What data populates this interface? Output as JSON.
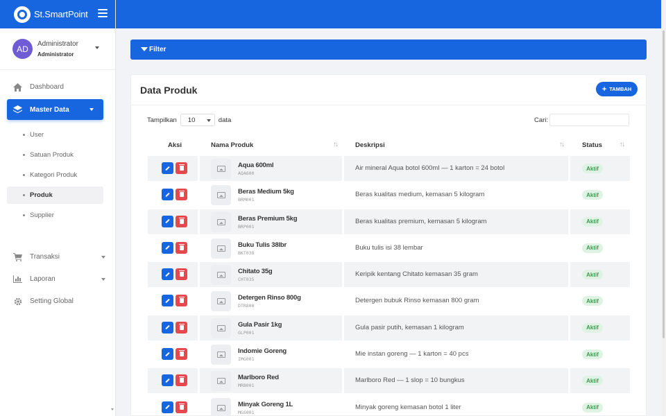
{
  "brand": {
    "name": "St.SmartPoint"
  },
  "user": {
    "initials": "AD",
    "name": "Administrator",
    "role": "Administrator"
  },
  "nav": {
    "dashboard": "Dashboard",
    "master_data": "Master Data",
    "sub": [
      "User",
      "Satuan Produk",
      "Kategori Produk",
      "Produk",
      "Supplier"
    ],
    "transaksi": "Transaksi",
    "laporan": "Laporan",
    "setting": "Setting Global"
  },
  "filter": {
    "label": "Filter"
  },
  "card": {
    "title": "Data Produk",
    "add_label": "TAMBAH"
  },
  "controls": {
    "show_label": "Tampilkan",
    "page_size": "10",
    "data_label": "data",
    "search_label": "Cari:"
  },
  "table": {
    "headers": {
      "aksi": "Aksi",
      "nama": "Nama Produk",
      "desk": "Deskripsi",
      "status": "Status"
    },
    "rows": [
      {
        "name": "Aqua 600ml",
        "code": "AQA600",
        "desc": "Air mineral Aqua botol 600ml — 1 karton = 24 botol",
        "status": "Aktif"
      },
      {
        "name": "Beras Medium 5kg",
        "code": "BRM001",
        "desc": "Beras kualitas medium, kemasan 5 kilogram",
        "status": "Aktif"
      },
      {
        "name": "Beras Premium 5kg",
        "code": "BRP001",
        "desc": "Beras kualitas premium, kemasan 5 kilogram",
        "status": "Aktif"
      },
      {
        "name": "Buku Tulis 38lbr",
        "code": "BKT038",
        "desc": "Buku tulis isi 38 lembar",
        "status": "Aktif"
      },
      {
        "name": "Chitato 35g",
        "code": "CHT035",
        "desc": "Keripik kentang Chitato kemasan 35 gram",
        "status": "Aktif"
      },
      {
        "name": "Detergen Rinso 800g",
        "code": "DTR800",
        "desc": "Detergen bubuk Rinso kemasan 800 gram",
        "status": "Aktif"
      },
      {
        "name": "Gula Pasir 1kg",
        "code": "GLP001",
        "desc": "Gula pasir putih, kemasan 1 kilogram",
        "status": "Aktif"
      },
      {
        "name": "Indomie Goreng",
        "code": "IMG001",
        "desc": "Mie instan goreng — 1 karton = 40 pcs",
        "status": "Aktif"
      },
      {
        "name": "Marlboro Red",
        "code": "MRB001",
        "desc": "Marlboro Red — 1 slop = 10 bungkus",
        "status": "Aktif"
      },
      {
        "name": "Minyak Goreng 1L",
        "code": "MGS001",
        "desc": "Minyak goreng kemasan botol 1 liter",
        "status": "Aktif"
      }
    ]
  },
  "colors": {
    "primary": "#1766e0",
    "danger": "#e5484d",
    "success_bg": "#dff3e4",
    "success_text": "#3a9a4e"
  }
}
